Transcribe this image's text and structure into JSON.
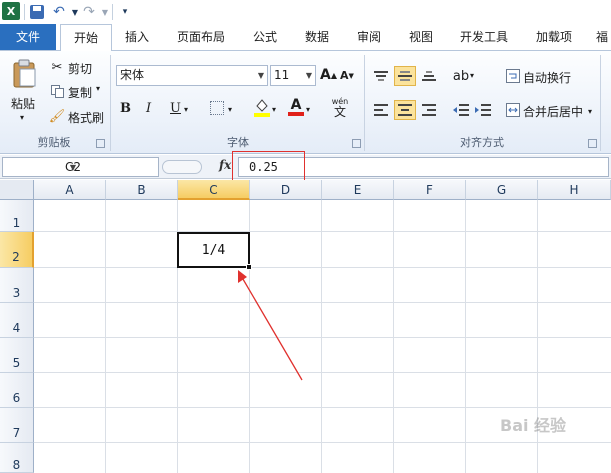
{
  "ribbon_tabs": [
    {
      "label": "文件"
    },
    {
      "label": "开始"
    },
    {
      "label": "插入"
    },
    {
      "label": "页面布局"
    },
    {
      "label": "公式"
    },
    {
      "label": "数据"
    },
    {
      "label": "审阅"
    },
    {
      "label": "视图"
    },
    {
      "label": "开发工具"
    },
    {
      "label": "加载项"
    },
    {
      "label": "福"
    }
  ],
  "clipboard": {
    "paste_label": "粘贴",
    "cut_label": "剪切",
    "copy_label": "复制",
    "format_painter_label": "格式刷",
    "group_label": "剪贴板"
  },
  "font": {
    "font_name": "宋体",
    "font_size": "11",
    "group_label": "字体",
    "bold": "B",
    "italic": "I",
    "underline": "U",
    "grow": "A",
    "shrink": "A",
    "font_color": "A",
    "phonetic": "wén",
    "phonetic_char": "文"
  },
  "alignment": {
    "wrap_text_label": "自动换行",
    "merge_center_label": "合并后居中",
    "group_label": "对齐方式"
  },
  "formula_bar": {
    "name_box": "C2",
    "fx_label": "fx",
    "formula_value": "0.25"
  },
  "grid": {
    "columns": [
      "A",
      "B",
      "C",
      "D",
      "E",
      "F",
      "G",
      "H"
    ],
    "rows": [
      "1",
      "2",
      "3",
      "4",
      "5",
      "6",
      "7",
      "8"
    ],
    "selected_cell": "C2",
    "cell_C2": "1/4"
  },
  "watermark": "Bai 经验",
  "colors": {
    "file_tab": "#2a6fbf",
    "selection_header": "#f6cd63",
    "annotation_red": "#e0312e"
  }
}
